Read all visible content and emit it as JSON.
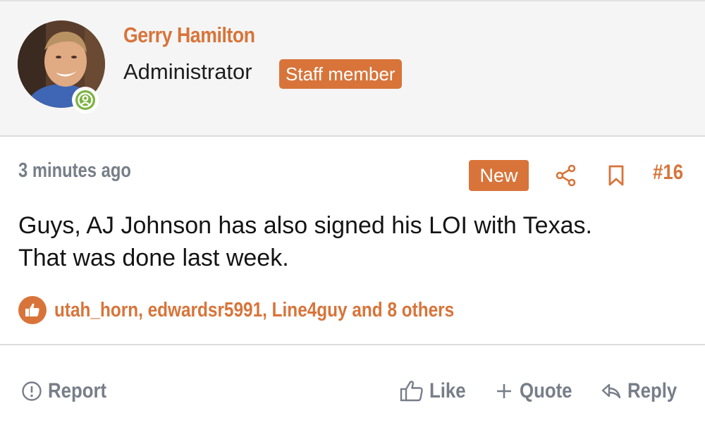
{
  "user": {
    "name": "Gerry Hamilton",
    "title": "Administrator",
    "badge": "Staff member"
  },
  "post": {
    "time": "3 minutes ago",
    "new_label": "New",
    "number": "#16",
    "body_line1": "Guys, AJ Johnson has also signed his LOI with Texas.",
    "body_line2": "That was done last week."
  },
  "reactions": {
    "text": "utah_horn, edwardsr5991, Line4guy and 8 others"
  },
  "actions": {
    "report": "Report",
    "like": "Like",
    "quote": "Quote",
    "reply": "Reply"
  },
  "colors": {
    "accent": "#d8743a",
    "muted": "#777e88",
    "online": "#7cb342"
  },
  "icons": [
    "online-user-icon",
    "share-icon",
    "bookmark-icon",
    "thumbs-up-icon",
    "report-icon",
    "like-icon",
    "quote-icon",
    "reply-icon"
  ]
}
